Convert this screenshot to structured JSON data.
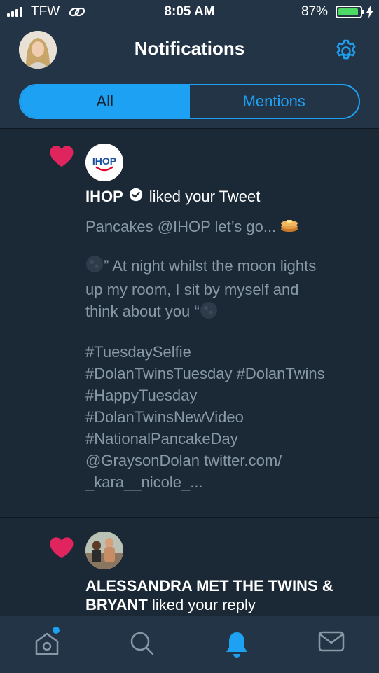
{
  "status": {
    "carrier": "TFW",
    "time": "8:05 AM",
    "battery_percent": "87%",
    "battery_level": 0.87
  },
  "header": {
    "title": "Notifications",
    "settings_icon": "gear-icon"
  },
  "tabs": [
    {
      "label": "All",
      "active": true
    },
    {
      "label": "Mentions",
      "active": false
    }
  ],
  "notifications": [
    {
      "type": "like",
      "icon": "heart-icon",
      "name": "IHOP",
      "verified": true,
      "action": "liked your Tweet",
      "logo_text": "IHOP",
      "tweet_lines": {
        "l1": "Pancakes @IHOP let’s go...",
        "l2": "” At night whilst the moon lights",
        "l3": "up my room, I sit by myself and",
        "l4": "think about you “",
        "l5": "#TuesdaySelfie",
        "l6": "#DolanTwinsTuesday #DolanTwins",
        "l7": "#HappyTuesday",
        "l8": "#DolanTwinsNewVideo",
        "l9": "#NationalPancakeDay",
        "l10": "@GraysonDolan twitter.com/",
        "l11": "_kara__nicole_..."
      }
    },
    {
      "type": "like",
      "icon": "heart-icon",
      "name": "ALESSANDRA MET THE TWINS & BRYANT",
      "action": "liked your reply"
    }
  ],
  "tabbar": {
    "home": "home-icon",
    "search": "search-icon",
    "notifications": "bell-icon",
    "messages": "mail-icon"
  },
  "colors": {
    "background": "#1b2836",
    "bar": "#243447",
    "accent": "#1da1f2",
    "like": "#e0245e",
    "muted": "#8899a6"
  }
}
